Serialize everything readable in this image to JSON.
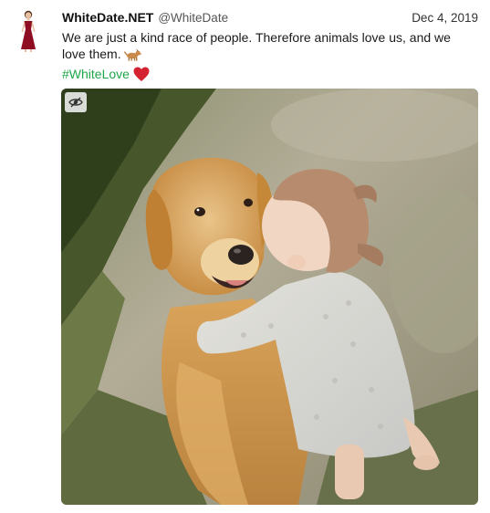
{
  "post": {
    "display_name": "WhiteDate.NET",
    "handle": "@WhiteDate",
    "date": "Dec 4, 2019",
    "text": "We are just a kind race of people. Therefore animals love us, and we love them.",
    "hashtag": "#WhiteLove",
    "emoji_inline": "dog-emoji",
    "emoji_after_hashtag": "red-heart-emoji"
  },
  "media": {
    "description_icon": "eye-slash-icon"
  },
  "colors": {
    "hashtag": "#1ea64a",
    "heart": "#d42230",
    "avatar_dress": "#8e0d23"
  }
}
